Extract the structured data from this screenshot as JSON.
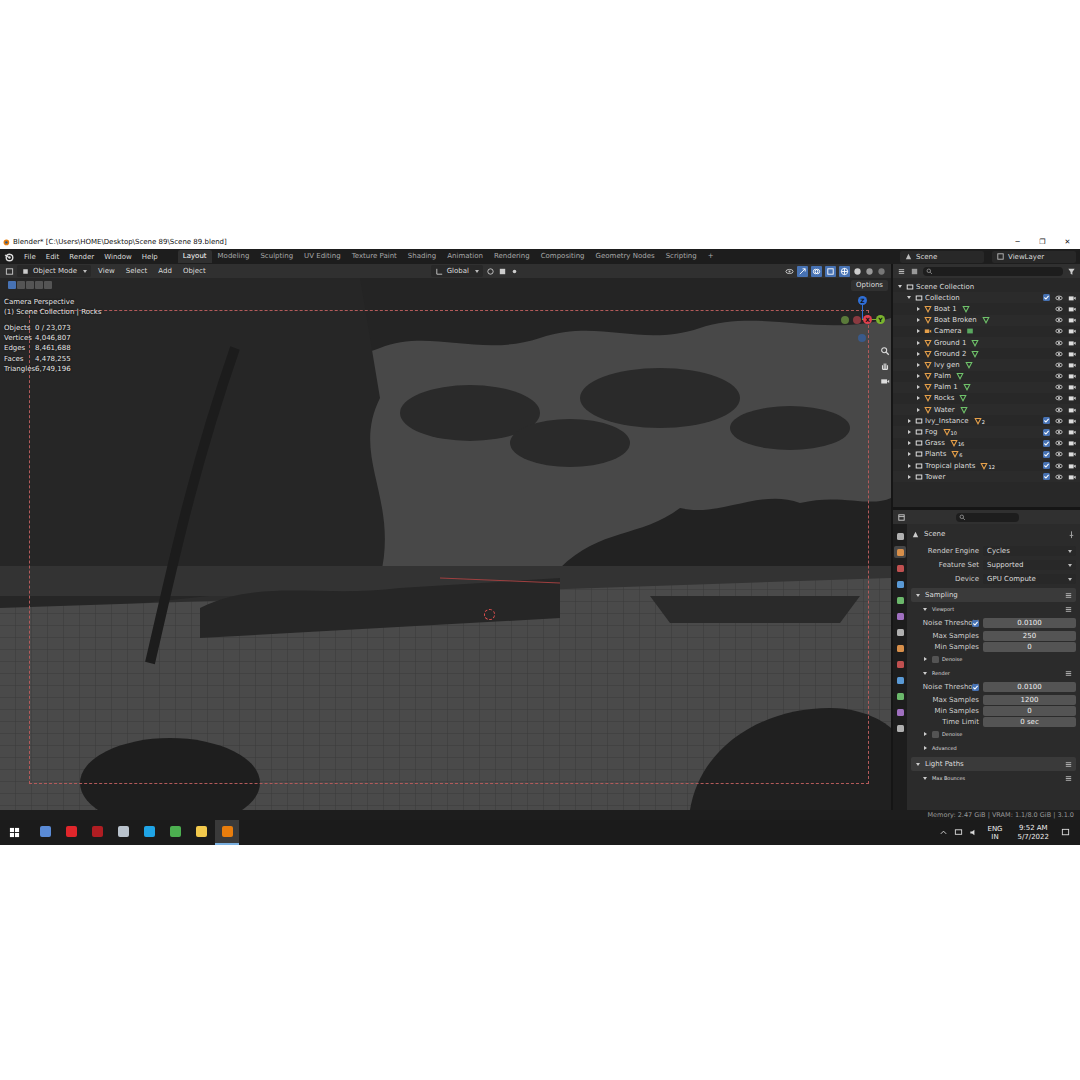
{
  "window": {
    "title": "Blender* [C:\\Users\\HOME\\Desktop\\Scene 89\\Scene 89.blend]",
    "controls": [
      "─",
      "❐",
      "✕"
    ]
  },
  "menu": [
    "File",
    "Edit",
    "Render",
    "Window",
    "Help"
  ],
  "workspaces": [
    {
      "label": "Layout",
      "selected": true
    },
    {
      "label": "Modeling",
      "selected": false
    },
    {
      "label": "Sculpting",
      "selected": false
    },
    {
      "label": "UV Editing",
      "selected": false
    },
    {
      "label": "Texture Paint",
      "selected": false
    },
    {
      "label": "Shading",
      "selected": false
    },
    {
      "label": "Animation",
      "selected": false
    },
    {
      "label": "Rendering",
      "selected": false
    },
    {
      "label": "Compositing",
      "selected": false
    },
    {
      "label": "Geometry Nodes",
      "selected": false
    },
    {
      "label": "Scripting",
      "selected": false
    }
  ],
  "add_workspace": "+",
  "scene": "Scene",
  "view_layer": "ViewLayer",
  "viewport_header": {
    "mode": "Object Mode",
    "menus": [
      "View",
      "Select",
      "Add",
      "Object"
    ],
    "orientation": "Global",
    "options": "Options"
  },
  "viewport": {
    "view": "Camera Perspective",
    "context": "(1) Scene Collection | Rocks",
    "stats": [
      {
        "label": "Objects",
        "value": "0 / 23,073"
      },
      {
        "label": "Vertices",
        "value": "4,046,807"
      },
      {
        "label": "Edges",
        "value": "8,461,688"
      },
      {
        "label": "Faces",
        "value": "4,478,255"
      },
      {
        "label": "Triangles",
        "value": "6,749,196"
      }
    ]
  },
  "gizmo": [
    {
      "axis": "Z",
      "color": "#2f6fd6"
    },
    {
      "axis": "X",
      "color": "#e0404f"
    },
    {
      "axis": "Y",
      "color": "#7bb32e"
    }
  ],
  "outliner": {
    "items": [
      {
        "name": "Scene Collection",
        "kind": "root",
        "depth": 0,
        "expanded": true,
        "checked": false,
        "visible": false,
        "renderable": false,
        "count": ""
      },
      {
        "name": "Collection",
        "kind": "collection",
        "depth": 1,
        "expanded": true,
        "checked": true,
        "visible": true,
        "renderable": true,
        "count": ""
      },
      {
        "name": "Boat 1",
        "kind": "mesh",
        "depth": 2,
        "expanded": false,
        "checked": false,
        "visible": true,
        "renderable": true,
        "count": ""
      },
      {
        "name": "Boat Broken",
        "kind": "mesh",
        "depth": 2,
        "expanded": false,
        "checked": false,
        "visible": true,
        "renderable": true,
        "count": ""
      },
      {
        "name": "Camera",
        "kind": "camera",
        "depth": 2,
        "expanded": false,
        "checked": false,
        "visible": true,
        "renderable": true,
        "count": ""
      },
      {
        "name": "Ground 1",
        "kind": "mesh",
        "depth": 2,
        "expanded": false,
        "checked": false,
        "visible": true,
        "renderable": true,
        "count": ""
      },
      {
        "name": "Ground 2",
        "kind": "mesh",
        "depth": 2,
        "expanded": false,
        "checked": false,
        "visible": true,
        "renderable": true,
        "count": ""
      },
      {
        "name": "Ivy gen",
        "kind": "mesh",
        "depth": 2,
        "expanded": false,
        "checked": false,
        "visible": true,
        "renderable": true,
        "count": ""
      },
      {
        "name": "Palm",
        "kind": "mesh",
        "depth": 2,
        "expanded": false,
        "checked": false,
        "visible": true,
        "renderable": true,
        "count": ""
      },
      {
        "name": "Palm 1",
        "kind": "mesh",
        "depth": 2,
        "expanded": false,
        "checked": false,
        "visible": true,
        "renderable": true,
        "count": ""
      },
      {
        "name": "Rocks",
        "kind": "mesh",
        "depth": 2,
        "expanded": false,
        "checked": false,
        "visible": true,
        "renderable": true,
        "count": ""
      },
      {
        "name": "Water",
        "kind": "mesh",
        "depth": 2,
        "expanded": false,
        "checked": false,
        "visible": true,
        "renderable": true,
        "count": ""
      },
      {
        "name": "Ivy_Instance",
        "kind": "collection",
        "depth": 1,
        "expanded": false,
        "checked": true,
        "visible": true,
        "renderable": true,
        "count": "2"
      },
      {
        "name": "Fog",
        "kind": "collection",
        "depth": 1,
        "expanded": false,
        "checked": true,
        "visible": true,
        "renderable": true,
        "count": "10"
      },
      {
        "name": "Grass",
        "kind": "collection",
        "depth": 1,
        "expanded": false,
        "checked": true,
        "visible": true,
        "renderable": true,
        "count": "16"
      },
      {
        "name": "Plants",
        "kind": "collection",
        "depth": 1,
        "expanded": false,
        "checked": true,
        "visible": true,
        "renderable": true,
        "count": "6"
      },
      {
        "name": "Tropical plants",
        "kind": "collection",
        "depth": 1,
        "expanded": false,
        "checked": true,
        "visible": true,
        "renderable": true,
        "count": "12"
      },
      {
        "name": "Tower",
        "kind": "collection",
        "depth": 1,
        "expanded": false,
        "checked": true,
        "visible": true,
        "renderable": true,
        "count": ""
      }
    ]
  },
  "properties": {
    "context": "Scene",
    "tabs": [
      {
        "selected": false
      },
      {
        "selected": true
      },
      {
        "selected": false
      },
      {
        "selected": false
      },
      {
        "selected": false
      },
      {
        "selected": false
      },
      {
        "selected": false
      },
      {
        "selected": false
      },
      {
        "selected": false
      },
      {
        "selected": false
      },
      {
        "selected": false
      },
      {
        "selected": false
      },
      {
        "selected": false
      }
    ],
    "rows": [
      {
        "kind": "dropdown",
        "label": "Render Engine",
        "value": "Cycles"
      },
      {
        "kind": "dropdown",
        "label": "Feature Set",
        "value": "Supported"
      },
      {
        "kind": "dropdown",
        "label": "Device",
        "value": "GPU Compute"
      },
      {
        "kind": "section",
        "label": "Sampling",
        "expanded": true
      },
      {
        "kind": "subsection",
        "label": "Viewport",
        "expanded": true
      },
      {
        "kind": "check-number",
        "label": "Noise Threshold",
        "value": "0.0100",
        "checked": true
      },
      {
        "kind": "number",
        "label": "Max Samples",
        "value": "250"
      },
      {
        "kind": "number",
        "label": "Min Samples",
        "value": "0"
      },
      {
        "kind": "check-subsection",
        "label": "Denoise",
        "expanded": false,
        "checked": false
      },
      {
        "kind": "subsection",
        "label": "Render",
        "expanded": true
      },
      {
        "kind": "check-number",
        "label": "Noise Threshold",
        "value": "0.0100",
        "checked": true
      },
      {
        "kind": "number",
        "label": "Max Samples",
        "value": "1200"
      },
      {
        "kind": "number",
        "label": "Min Samples",
        "value": "0"
      },
      {
        "kind": "number",
        "label": "Time Limit",
        "value": "0 sec"
      },
      {
        "kind": "check-subsection",
        "label": "Denoise",
        "expanded": false,
        "checked": false
      },
      {
        "kind": "subsection",
        "label": "Advanced",
        "expanded": false
      },
      {
        "kind": "section",
        "label": "Light Paths",
        "expanded": true
      },
      {
        "kind": "subsection",
        "label": "Max Bounces",
        "expanded": true
      }
    ]
  },
  "status_bar": "Memory: 2.47 GiB | VRAM: 1.1/8.0 GiB | 3.1.0",
  "taskbar": {
    "apps": [
      {
        "active": false,
        "color": "#5a8bd6"
      },
      {
        "active": false,
        "color": "#e0262b"
      },
      {
        "active": false,
        "color": "#b01d22"
      },
      {
        "active": false,
        "color": "#b9c2cc"
      },
      {
        "active": false,
        "color": "#1fa4e6"
      },
      {
        "active": false,
        "color": "#4caf50"
      },
      {
        "active": false,
        "color": "#f2c94c"
      },
      {
        "active": true,
        "color": "#e87d0d"
      }
    ],
    "tray": {
      "language": "ENG",
      "region": "IN",
      "time": "9:52 AM",
      "date": "5/7/2022"
    }
  }
}
